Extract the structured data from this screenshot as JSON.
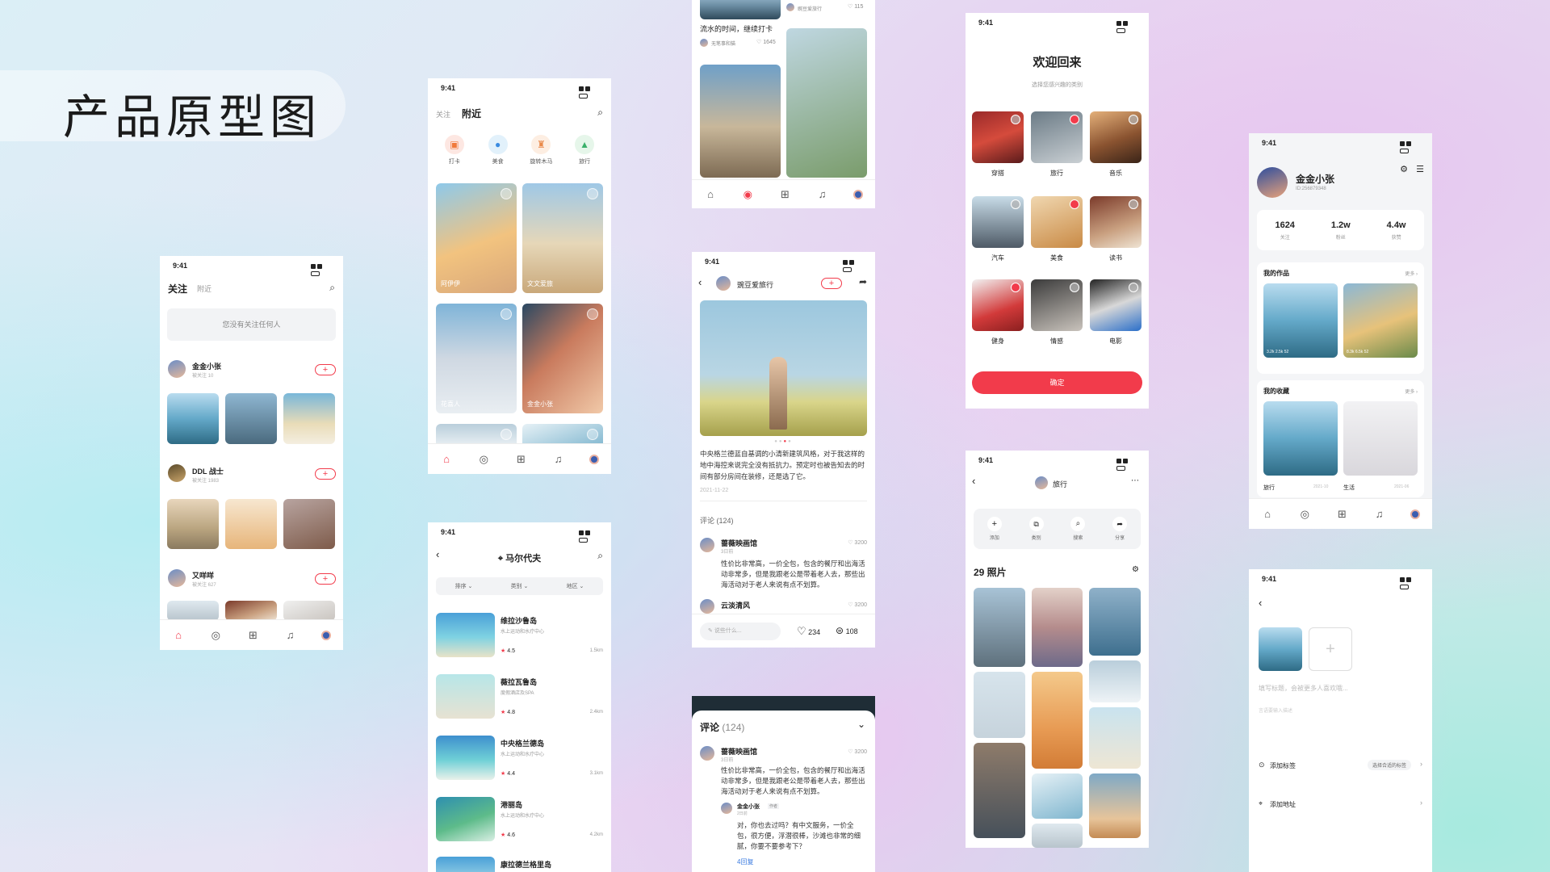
{
  "page_title": "产品原型图",
  "status_time": "9:41",
  "s1": {
    "tab_active": "关注",
    "tab_other": "附近",
    "empty": "您没有关注任何人",
    "users": [
      {
        "name": "金金小张",
        "sub": "被关注 10"
      },
      {
        "name": "DDL 战士",
        "sub": "被关注 1983"
      },
      {
        "name": "又咩咩",
        "sub": "被关注 627"
      }
    ],
    "follow": "+"
  },
  "s2": {
    "tab_other": "关注",
    "tab_active": "附近",
    "cats": [
      "打卡",
      "美食",
      "旋转木马",
      "旅行"
    ],
    "tags": [
      "阿伊伊",
      "文文爱旅",
      "花喜人",
      "金金小张"
    ]
  },
  "s3": {
    "caption": "流水的时间，继续打卡",
    "user": "无笔事和猫",
    "likes1": "1645",
    "user2": "豌豆爱旅行",
    "likes2": "115"
  },
  "s4": {
    "author": "豌豆爱旅行",
    "follow": "+",
    "body": "中央格兰德蓝自基调的小清新建筑风格，对于我这样的地中海控来说完全没有抵抗力。预定时也被告知去的时间有部分房间在装修，还是选了它。",
    "date": "2021-11-22",
    "comments_label": "评论 (124)",
    "c1_name": "蔷薇映画馆",
    "c1_sub": "3日前",
    "c1_likes": "3200",
    "c1_text": "性价比非常高，一价全包，包含的餐厅和出海活动非常多，但是我跟老公是带着老人去，那些出海活动对于老人来说有点不划算。",
    "c2_name": "云淡清风",
    "c2_likes": "3200",
    "input_ph": "说些什么...",
    "likes": "234",
    "comments": "108"
  },
  "s5": {
    "title": "欢迎回来",
    "sub": "选择您感兴趣的类别",
    "cats": [
      "穿搭",
      "旅行",
      "音乐",
      "汽车",
      "美食",
      "读书",
      "健身",
      "情感",
      "电影"
    ],
    "confirm": "确定"
  },
  "s6": {
    "name": "金金小张",
    "id": "ID:256879348",
    "stats": [
      {
        "v": "1624",
        "l": "关注"
      },
      {
        "v": "1.2w",
        "l": "粉丝"
      },
      {
        "v": "4.4w",
        "l": "获赞"
      }
    ],
    "works": "我的作品",
    "more": "更多",
    "fav": "我的收藏",
    "fav1": "旅行",
    "fav1d": "2021-10",
    "fav2": "生活",
    "fav2d": "2021-06",
    "w1": [
      "3.2k",
      "2.5k",
      "52"
    ],
    "w2": [
      "8.3k",
      "6.5k",
      "52"
    ]
  },
  "s7": {
    "title": "马尔代夫",
    "filters": [
      "排序",
      "类别",
      "地区"
    ],
    "items": [
      {
        "name": "维拉沙鲁岛",
        "sub": "水上运动和水疗中心",
        "rating": "4.5",
        "dist": "1.5km"
      },
      {
        "name": "薇拉瓦鲁岛",
        "sub": "度假酒店及SPA",
        "rating": "4.8",
        "dist": "2.4km"
      },
      {
        "name": "中央格兰德岛",
        "sub": "水上运动和水疗中心",
        "rating": "4.4",
        "dist": "3.1km"
      },
      {
        "name": "港丽岛",
        "sub": "水上运动和水疗中心",
        "rating": "4.6",
        "dist": "4.2km"
      },
      {
        "name": "康拉德兰格里岛"
      }
    ]
  },
  "s8": {
    "comments_label": "评论",
    "count": "(124)",
    "name": "蔷薇映画馆",
    "sub": "3日前",
    "likes": "3200",
    "text": "性价比非常高，一价全包，包含的餐厅和出海活动非常多，但是我跟老公是带着老人去，那些出海活动对于老人来说有点不划算。",
    "reply_name": "金金小张",
    "reply_tag": "作者",
    "reply_sub": "2日前",
    "reply_text": "对，你也去过吗？有中文服务，一价全包，很方便，浮潜很棒，沙滩也非常的细腻，你要不要参考下？",
    "more_replies": "4回复"
  },
  "s9": {
    "title": "旅行",
    "actions": [
      "添加",
      "类别",
      "搜索",
      "分享"
    ],
    "count": "29 照片"
  },
  "s10": {
    "title_ph": "填写标题，会被更多人喜欢哦...",
    "body_ph": "言语要输入描述",
    "tag": "添加标签",
    "tag_hint": "选择合适的标签",
    "addr": "添加地址"
  }
}
